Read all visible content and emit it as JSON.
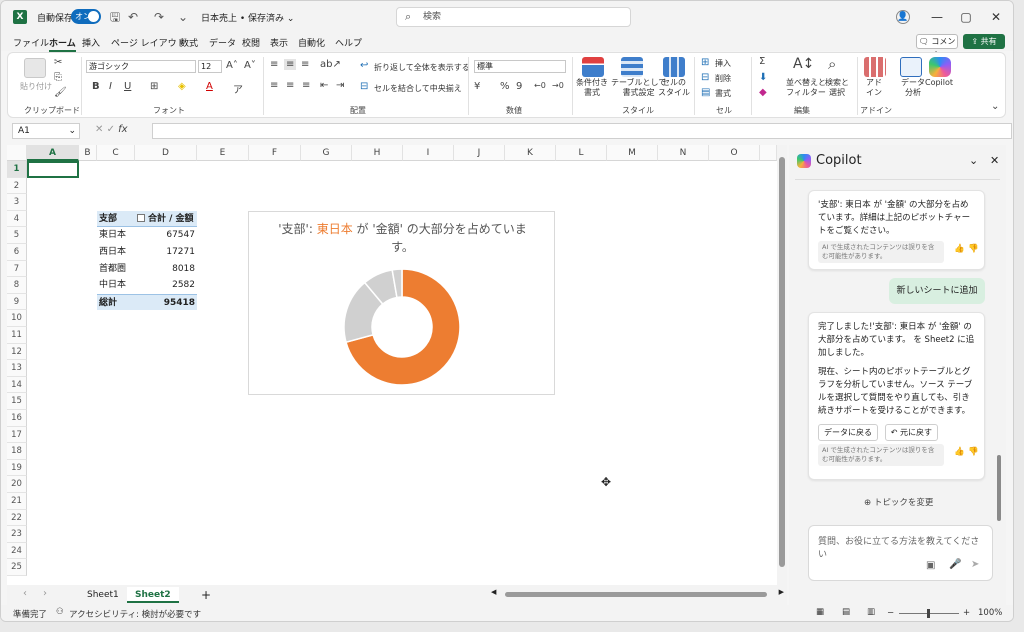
{
  "titlebar": {
    "autosave_label": "自動保存",
    "autosave_toggle": "オン",
    "doc_title": "日本売上 • 保存済み ⌄",
    "search_placeholder": "検索"
  },
  "menubar": {
    "items": [
      "ファイル",
      "ホーム",
      "挿入",
      "ページ レイアウト",
      "数式",
      "データ",
      "校閲",
      "表示",
      "自動化",
      "ヘルプ"
    ],
    "comment_label": "コメント",
    "share_label": "共有"
  },
  "ribbon": {
    "clipboard": {
      "paste_label": "貼り付け",
      "group_label": "クリップボード"
    },
    "font": {
      "font_name": "游ゴシック",
      "font_size": "12",
      "group_label": "フォント"
    },
    "alignment": {
      "wrap_label": "折り返して全体を表示する",
      "merge_label": "セルを結合して中央揃え",
      "group_label": "配置"
    },
    "number": {
      "format": "標準",
      "group_label": "数値"
    },
    "styles": {
      "cond_label": "条件付き\n書式",
      "table_label": "テーブルとして\n書式設定",
      "cell_label": "セルの\nスタイル",
      "group_label": "スタイル"
    },
    "cells": {
      "insert_label": "挿入",
      "delete_label": "削除",
      "format_label": "書式",
      "group_label": "セル"
    },
    "editing": {
      "sort_label": "並べ替えと\nフィルター",
      "find_label": "検索と\n選択",
      "group_label": "編集"
    },
    "addins": {
      "addin_label": "アド\nイン",
      "analyze_label": "データ\n分析",
      "copilot_label": "Copilot",
      "group_label": "アドイン"
    }
  },
  "formula_bar": {
    "name_box": "A1",
    "fx": "fx",
    "formula": ""
  },
  "sheet": {
    "columns": [
      "A",
      "B",
      "C",
      "D",
      "E",
      "F",
      "G",
      "H",
      "I",
      "J",
      "K",
      "L",
      "M",
      "N",
      "O"
    ],
    "rows": [
      "1",
      "2",
      "3",
      "4",
      "5",
      "6",
      "7",
      "8",
      "9",
      "10",
      "11",
      "12",
      "13",
      "14",
      "15",
      "16",
      "17",
      "18",
      "19",
      "20",
      "21",
      "22",
      "23",
      "24",
      "25"
    ]
  },
  "pivot": {
    "header_left": "支部",
    "header_right": "合計 / 金額",
    "rows": [
      {
        "label": "東日本",
        "value": "67547"
      },
      {
        "label": "西日本",
        "value": "17271"
      },
      {
        "label": "首都圏",
        "value": "8018"
      },
      {
        "label": "中日本",
        "value": "2582"
      }
    ],
    "total_label": "総計",
    "total_value": "95418"
  },
  "chart": {
    "title_prefix": "'支部': ",
    "title_highlight": "東日本",
    "title_suffix": " が '金額' の大部分を占めています。",
    "accent_color": "#ED7D31",
    "other_color": "#D0D0D0"
  },
  "chart_data": {
    "type": "pie",
    "categories": [
      "東日本",
      "西日本",
      "首都圏",
      "中日本"
    ],
    "values": [
      67547,
      17271,
      8018,
      2582
    ],
    "title": "'支部': 東日本 が '金額' の大部分を占めています。",
    "donut": true
  },
  "tabs": {
    "items": [
      "Sheet1",
      "Sheet2"
    ],
    "active": "Sheet2",
    "add": "+"
  },
  "statusbar": {
    "ready": "準備完了",
    "accessibility": "アクセシビリティ: 検討が必要です",
    "zoom": "100%"
  },
  "copilot": {
    "title": "Copilot",
    "msg1": "'支部': 東日本 が '金額' の大部分を占めています。詳細は上記のピボットチャートをご覧ください。",
    "disclaimer": "AI で生成されたコンテンツは誤りを含む可能性があります。",
    "user_msg": "新しいシートに追加",
    "msg2_p1": "完了しました!'支部': 東日本 が '金額' の大部分を占めています。 を Sheet2 に追加しました。",
    "msg2_p2": "現在、シート内のピボットテーブルとグラフを分析していません。ソース テーブルを選択して質問をやり直しても、引き続きサポートを受けることができます。",
    "action_data": "データに戻る",
    "action_undo": "元に戻す",
    "change_topic": "トピックを変更",
    "input_placeholder": "質問、お役に立てる方法を教えてください"
  }
}
